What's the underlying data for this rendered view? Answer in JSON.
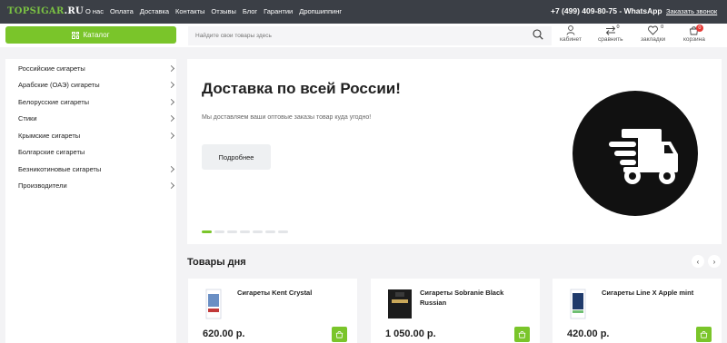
{
  "topbar": {
    "logo_main": "TOPSIGAR",
    "logo_dot": ".RU",
    "nav": [
      "О нас",
      "Оплата",
      "Доставка",
      "Контакты",
      "Отзывы",
      "Блог",
      "Гарантии",
      "Дропшиппинг"
    ],
    "phone": "+7 (499) 409-80-75 - WhatsApp",
    "callback": "Заказать звонок"
  },
  "header": {
    "catalog_label": "Каталог",
    "search_placeholder": "Найдите свои товары здесь",
    "account_label": "кабинет",
    "compare_label": "сравнить",
    "compare_count": "0",
    "bookmarks_label": "закладки",
    "bookmarks_count": "0",
    "cart_label": "корзина",
    "cart_count": "0"
  },
  "sidebar": {
    "items": [
      {
        "label": "Российские сигареты",
        "has_children": true
      },
      {
        "label": "Арабские (ОАЭ) сигареты",
        "has_children": true
      },
      {
        "label": "Белорусские сигареты",
        "has_children": true
      },
      {
        "label": "Стики",
        "has_children": true
      },
      {
        "label": "Крымские сигареты",
        "has_children": true
      },
      {
        "label": "Болгарские сигареты",
        "has_children": false
      },
      {
        "label": "Безникотиновые сигареты",
        "has_children": true
      },
      {
        "label": "Производители",
        "has_children": true
      }
    ]
  },
  "banner": {
    "title": "Доставка по всей России!",
    "subtitle": "Мы доставляем ваши оптовые заказы товар куда угодно!",
    "button": "Подробнее",
    "icon": "delivery-truck-icon",
    "slide_count": 7,
    "active_slide": 1
  },
  "products": {
    "title": "Товары дня",
    "items": [
      {
        "name": "Сигареты Kent Crystal",
        "price": "620.00 р."
      },
      {
        "name": "Сигареты Sobranie Black Russian",
        "price": "1 050.00 р."
      },
      {
        "name": "Сигареты Line X Apple mint",
        "price": "420.00 р."
      }
    ]
  },
  "colors": {
    "accent": "#7ac52a",
    "topbar": "#3b3f46",
    "badge": "#e53935"
  }
}
